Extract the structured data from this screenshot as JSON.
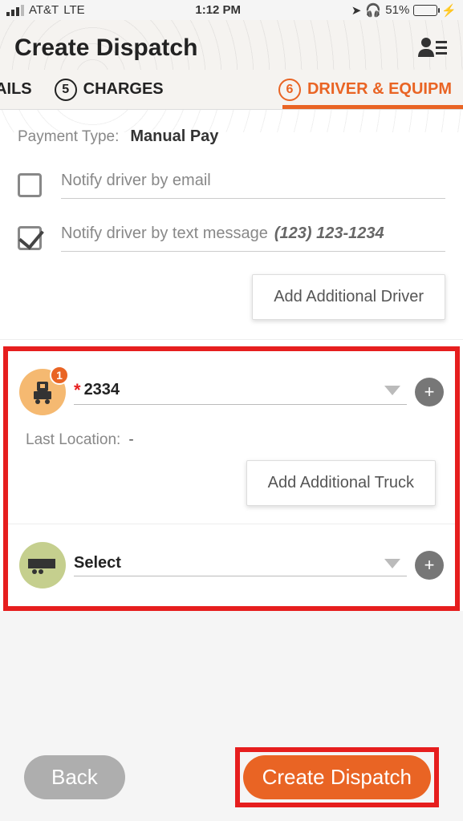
{
  "status": {
    "carrier": "AT&T",
    "network": "LTE",
    "time": "1:12 PM",
    "battery_pct": "51%"
  },
  "header": {
    "title": "Create Dispatch"
  },
  "tabs": {
    "details_label": "ETAILS",
    "charges_num": "5",
    "charges_label": "CHARGES",
    "driver_num": "6",
    "driver_label": "DRIVER & EQUIPM"
  },
  "payment": {
    "label": "Payment Type:",
    "value": "Manual Pay"
  },
  "notify_email": {
    "label": "Notify driver by email",
    "checked": false
  },
  "notify_sms": {
    "label": "Notify driver by text message",
    "phone": "(123) 123-1234",
    "checked": true
  },
  "add_driver_btn": "Add Additional Driver",
  "truck": {
    "badge": "1",
    "value": "2334",
    "required": "*",
    "last_location_label": "Last Location:",
    "last_location_value": "-",
    "add_btn": "Add Additional Truck"
  },
  "trailer": {
    "placeholder": "Select"
  },
  "footer": {
    "back": "Back",
    "create": "Create Dispatch"
  }
}
